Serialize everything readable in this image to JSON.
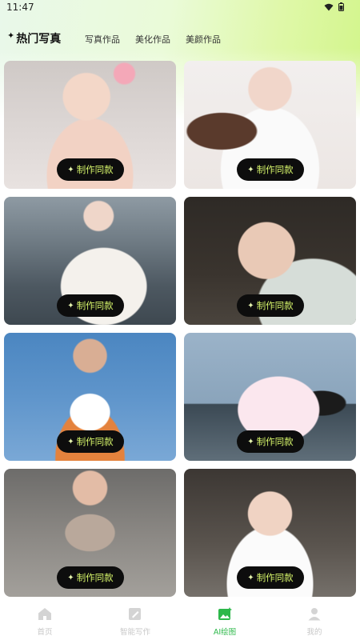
{
  "status_bar": {
    "time": "11:47"
  },
  "tabs": {
    "hot_label": "热门写真",
    "items": [
      "写真作品",
      "美化作品",
      "美颜作品"
    ]
  },
  "cards": [
    {
      "button_label": "制作同款"
    },
    {
      "button_label": "制作同款"
    },
    {
      "button_label": "制作同款"
    },
    {
      "button_label": "制作同款"
    },
    {
      "button_label": "制作同款"
    },
    {
      "button_label": "制作同款"
    },
    {
      "button_label": "制作同款"
    },
    {
      "button_label": "制作同款"
    }
  ],
  "bottom_nav": {
    "items": [
      {
        "label": "首页",
        "icon": "home-icon"
      },
      {
        "label": "智能写作",
        "icon": "edit-icon"
      },
      {
        "label": "AI绘图",
        "icon": "ai-image-icon"
      },
      {
        "label": "我的",
        "icon": "user-icon"
      }
    ],
    "active_index": 2
  },
  "colors": {
    "accent_green": "#2db84a",
    "button_bg": "#0d0d0d",
    "button_text": "#d6f56a"
  }
}
